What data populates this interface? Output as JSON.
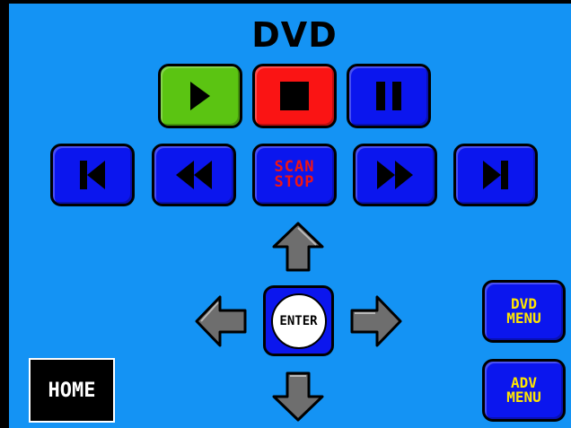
{
  "panel": {
    "title": "DVD"
  },
  "transport": {
    "play_icon": "play-icon",
    "stop_icon": "stop-icon",
    "pause_icon": "pause-icon",
    "skip_back_icon": "skip-previous-icon",
    "rewind_icon": "rewind-icon",
    "scan_stop_line1": "SCAN",
    "scan_stop_line2": "STOP",
    "fast_forward_icon": "fast-forward-icon",
    "skip_forward_icon": "skip-next-icon"
  },
  "navigation": {
    "up_icon": "arrow-up-icon",
    "down_icon": "arrow-down-icon",
    "left_icon": "arrow-left-icon",
    "right_icon": "arrow-right-icon",
    "enter_label": "ENTER"
  },
  "menus": {
    "dvd_menu_line1": "DVD",
    "dvd_menu_line2": "MENU",
    "adv_menu_line1": "ADV",
    "adv_menu_line2": "MENU"
  },
  "home": {
    "label": "HOME"
  },
  "colors": {
    "background": "#1493f4",
    "button_blue": "#0b16ee",
    "play_green": "#5bc412",
    "stop_red": "#fa1414",
    "scan_text": "#f01414",
    "menu_text": "#ffe600",
    "arrow_gray": "#6e6e6e"
  }
}
